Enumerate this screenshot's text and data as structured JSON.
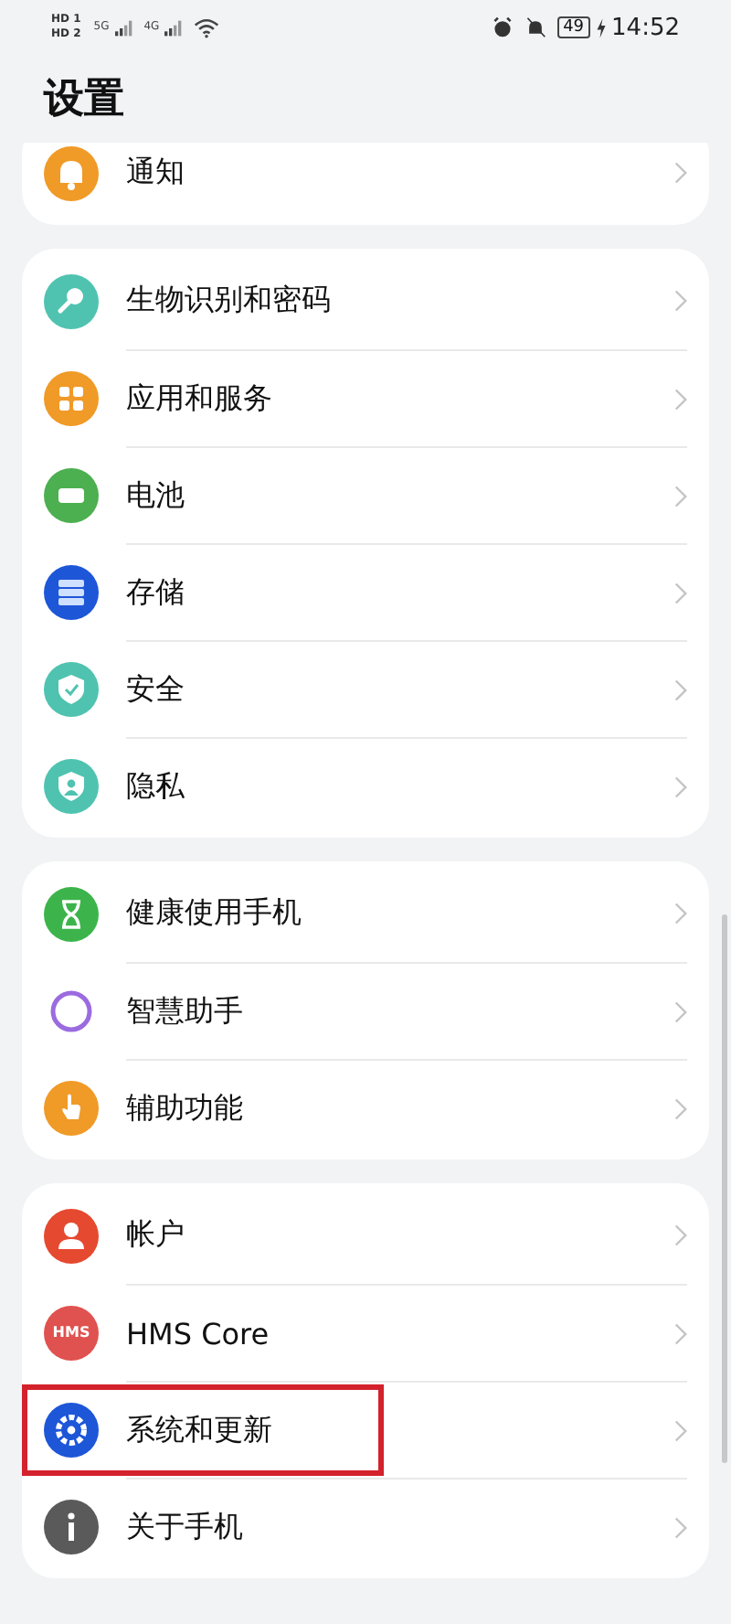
{
  "status_bar": {
    "sims": [
      {
        "label": "HD",
        "slot": "1"
      },
      {
        "label": "HD",
        "slot": "2"
      }
    ],
    "networks": [
      "5G",
      "4G"
    ],
    "battery": "49",
    "charging": true,
    "time": "14:52"
  },
  "title": "设置",
  "groups": [
    {
      "clipped": true,
      "items": [
        {
          "label": "通知",
          "kind": "bell",
          "color": "#f09a27",
          "highlighted": false
        }
      ]
    },
    {
      "clipped": false,
      "items": [
        {
          "label": "生物识别和密码",
          "kind": "key",
          "color": "#4fc3b0",
          "highlighted": false
        },
        {
          "label": "应用和服务",
          "kind": "apps",
          "color": "#f09a27",
          "highlighted": false
        },
        {
          "label": "电池",
          "kind": "battery",
          "color": "#4caf50",
          "highlighted": false
        },
        {
          "label": "存储",
          "kind": "storage",
          "color": "#1e56d8",
          "highlighted": false
        },
        {
          "label": "安全",
          "kind": "shield",
          "color": "#4fc3b0",
          "highlighted": false
        },
        {
          "label": "隐私",
          "kind": "privacy",
          "color": "#4fc3b0",
          "highlighted": false
        }
      ]
    },
    {
      "clipped": false,
      "items": [
        {
          "label": "健康使用手机",
          "kind": "hourglass",
          "color": "#3cb44b",
          "highlighted": false
        },
        {
          "label": "智慧助手",
          "kind": "ring",
          "color": "#9b6be0",
          "highlighted": false
        },
        {
          "label": "辅助功能",
          "kind": "hand",
          "color": "#f09a27",
          "highlighted": false
        }
      ]
    },
    {
      "clipped": false,
      "items": [
        {
          "label": "帐户",
          "kind": "person",
          "color": "#e5492f",
          "highlighted": false
        },
        {
          "label": "HMS Core",
          "kind": "text",
          "icon_text": "HMS",
          "color": "#e0524f",
          "highlighted": false
        },
        {
          "label": "系统和更新",
          "kind": "gear",
          "color": "#1e56d8",
          "highlighted": true
        },
        {
          "label": "关于手机",
          "kind": "info",
          "color": "#5a5a5a",
          "highlighted": false
        }
      ]
    }
  ]
}
